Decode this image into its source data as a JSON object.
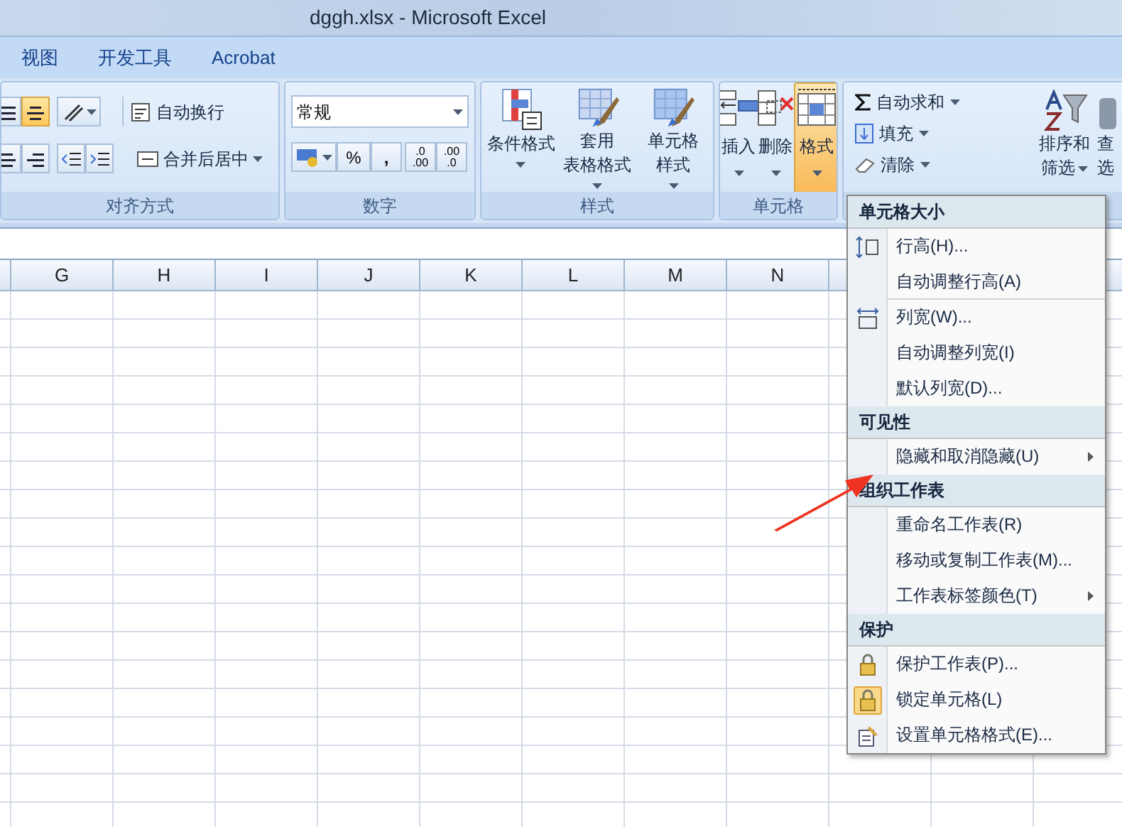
{
  "window": {
    "title": "dggh.xlsx - Microsoft Excel"
  },
  "tabs": [
    {
      "label": "视图",
      "selected": false
    },
    {
      "label": "开发工具",
      "selected": false
    },
    {
      "label": "Acrobat",
      "selected": false
    }
  ],
  "alignment": {
    "label": "对齐方式",
    "top_buttons": [
      {
        "selected": false
      },
      {
        "selected": true
      }
    ],
    "bottom_buttons": [
      {
        "selected": false
      },
      {
        "selected": false
      },
      {
        "selected": false
      },
      {
        "selected": false
      }
    ],
    "wrap_text": "自动换行",
    "merge": "合并后居中"
  },
  "number": {
    "label": "数字",
    "format": "常规",
    "percent": "%",
    "comma": ",",
    "increase_decimal": [
      ".0",
      ".00"
    ],
    "decrease_decimal": [
      ".00",
      ".0"
    ]
  },
  "styles": {
    "label": "样式",
    "buttons": [
      {
        "lines": [
          "条件格式"
        ]
      },
      {
        "lines": [
          "套用",
          "表格格式"
        ]
      },
      {
        "lines": [
          "单元格",
          "样式"
        ]
      }
    ]
  },
  "cells": {
    "label": "单元格",
    "buttons": [
      {
        "label": "插入",
        "selected": false
      },
      {
        "label": "删除",
        "selected": false
      },
      {
        "label": "格式",
        "selected": true
      }
    ]
  },
  "editing": {
    "autosum": "自动求和",
    "fill": "填充",
    "clear": "清除",
    "sort": [
      "排序和",
      "筛选"
    ],
    "find": [
      "查",
      "选"
    ]
  },
  "columns": [
    "G",
    "H",
    "I",
    "J",
    "K",
    "L",
    "M",
    "N"
  ],
  "menu": {
    "sections": [
      {
        "title": "单元格大小",
        "items": [
          {
            "label": "行高(H)...",
            "submenu": false,
            "divider_after": false
          },
          {
            "label": "自动调整行高(A)",
            "submenu": false,
            "divider_after": true
          },
          {
            "label": "列宽(W)...",
            "submenu": false,
            "divider_after": false
          },
          {
            "label": "自动调整列宽(I)",
            "submenu": false,
            "divider_after": false
          },
          {
            "label": "默认列宽(D)...",
            "submenu": false,
            "divider_after": false
          }
        ]
      },
      {
        "title": "可见性",
        "items": [
          {
            "label": "隐藏和取消隐藏(U)",
            "submenu": true,
            "divider_after": false
          }
        ]
      },
      {
        "title": "组织工作表",
        "items": [
          {
            "label": "重命名工作表(R)",
            "submenu": false,
            "divider_after": false
          },
          {
            "label": "移动或复制工作表(M)...",
            "submenu": false,
            "divider_after": false
          },
          {
            "label": "工作表标签颜色(T)",
            "submenu": true,
            "divider_after": false
          }
        ]
      },
      {
        "title": "保护",
        "items": [
          {
            "label": "保护工作表(P)...",
            "submenu": false,
            "divider_after": false,
            "checked": false
          },
          {
            "label": "锁定单元格(L)",
            "submenu": false,
            "divider_after": false,
            "checked": true
          },
          {
            "label": "设置单元格格式(E)...",
            "submenu": false,
            "divider_after": false,
            "checked": false
          }
        ]
      }
    ]
  }
}
